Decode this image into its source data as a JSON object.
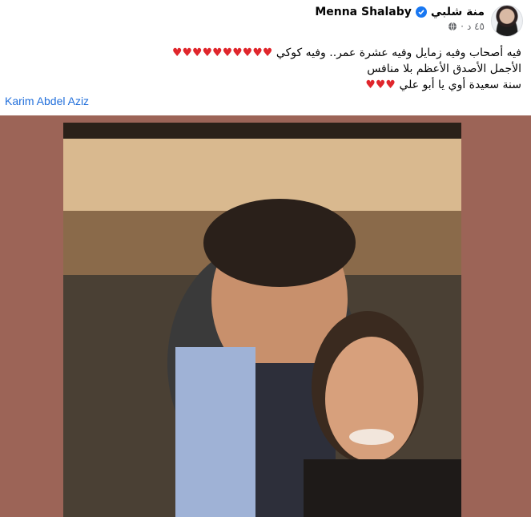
{
  "author": {
    "name_ar": "منة شلبي",
    "name_en": "Menna Shalaby"
  },
  "post": {
    "time": "٤٥ د",
    "dot": "·",
    "line1": "فيه أصحاب وفيه زمايل وفيه عشرة عمر.. وفيه كوكي",
    "line1_hearts": "♥♥♥♥♥♥♥♥♥♥",
    "line2": "الأجمل الأصدق الأعظم بلا منافس",
    "line3": "سنة سعيدة أوي يا أبو علي",
    "line3_hearts": "♥♥♥",
    "tag": "Karim Abdel Aziz"
  },
  "colors": {
    "photo_bg": "#9c6457",
    "link": "#216fdb",
    "heart": "#e0262c",
    "verified": "#1877f2"
  }
}
